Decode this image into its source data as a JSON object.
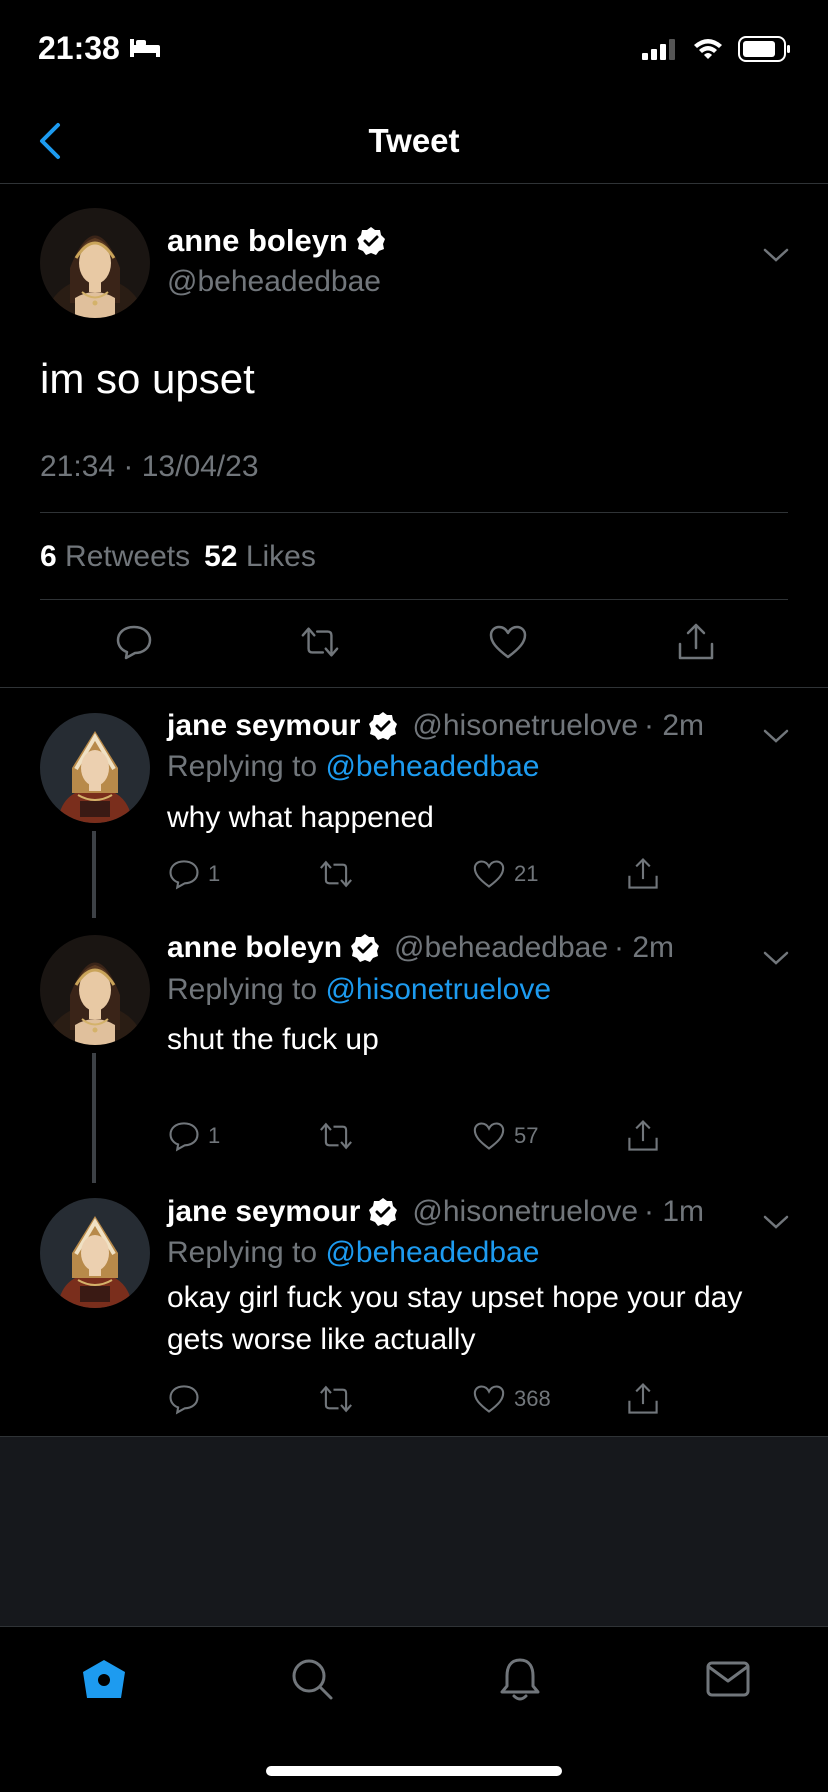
{
  "status_bar": {
    "time": "21:38",
    "sleep_icon": "bed-icon",
    "signal_icon": "cellular-signal-icon",
    "wifi_icon": "wifi-icon",
    "battery_icon": "battery-icon"
  },
  "nav": {
    "title": "Tweet",
    "back_icon": "chevron-left-icon"
  },
  "colors": {
    "accent": "#1d9bf0",
    "muted": "#71767b",
    "background": "#000000",
    "divider": "#2f3336"
  },
  "main_tweet": {
    "name": "anne boleyn",
    "handle": "@beheadedbae",
    "text": "im so upset",
    "timestamp": "21:34 · 13/04/23",
    "retweet_count": "6",
    "retweet_label": "Retweets",
    "like_count": "52",
    "like_label": "Likes"
  },
  "replies": [
    {
      "name": "jane seymour",
      "handle": "@hisonetruelove",
      "age": "· 2m",
      "replying_label": "Replying to",
      "replying_to": "@beheadedbae",
      "text": "why what happened",
      "reply_count": "1",
      "retweet_count": "",
      "like_count": "21"
    },
    {
      "name": "anne boleyn",
      "handle": "@beheadedbae",
      "age": "· 2m",
      "replying_label": "Replying to",
      "replying_to": "@hisonetruelove",
      "text": "shut the fuck up",
      "reply_count": "1",
      "retweet_count": "",
      "like_count": "57"
    },
    {
      "name": "jane seymour",
      "handle": "@hisonetruelove",
      "age": "· 1m",
      "replying_label": "Replying to",
      "replying_to": "@beheadedbae",
      "text": "okay girl fuck you stay upset hope your day gets worse like actually",
      "reply_count": "",
      "retweet_count": "",
      "like_count": "368"
    }
  ],
  "tab_bar": {
    "items": [
      "home-icon",
      "search-icon",
      "notifications-icon",
      "messages-icon"
    ]
  }
}
